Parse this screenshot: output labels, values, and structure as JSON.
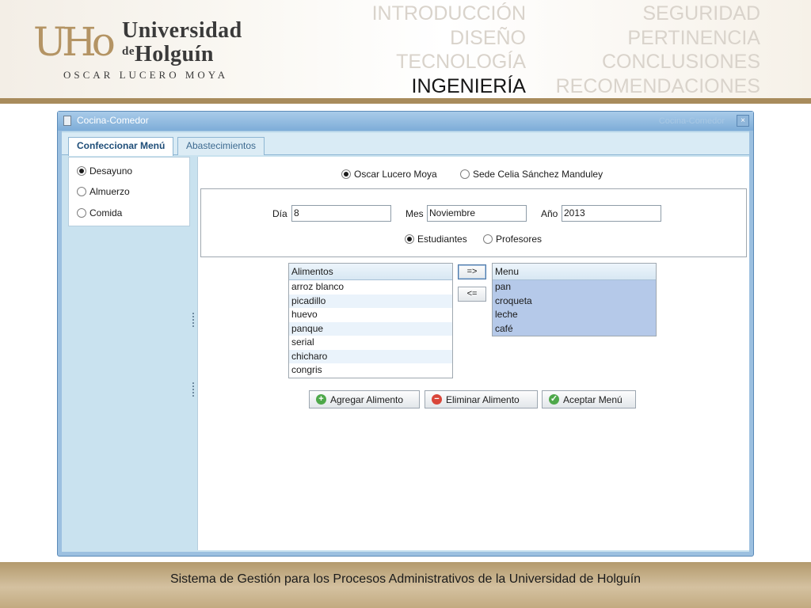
{
  "header": {
    "logo_mark": "UHo",
    "logo_line1": "Universidad",
    "logo_prefix": "de",
    "logo_line2": "Holguín",
    "logo_author": "OSCAR LUCERO MOYA",
    "nav_left": [
      {
        "label": "INTRODUCCIÓN",
        "active": false
      },
      {
        "label": "DISEÑO",
        "active": false
      },
      {
        "label": "TECNOLOGÍA",
        "active": false
      },
      {
        "label": "INGENIERÍA",
        "active": true
      }
    ],
    "nav_right": [
      {
        "label": "SEGURIDAD",
        "active": false
      },
      {
        "label": "PERTINENCIA",
        "active": false
      },
      {
        "label": "CONCLUSIONES",
        "active": false
      },
      {
        "label": "RECOMENDACIONES",
        "active": false
      }
    ]
  },
  "window": {
    "title": "Cocina-Comedor",
    "faint_caption": "Cocina-Comedor",
    "close_glyph": "×",
    "tabs": [
      {
        "label": "Confeccionar Menú",
        "active": true
      },
      {
        "label": "Abastecimientos",
        "active": false
      }
    ]
  },
  "meal_types": [
    {
      "label": "Desayuno",
      "selected": true
    },
    {
      "label": "Almuerzo",
      "selected": false
    },
    {
      "label": "Comida",
      "selected": false
    }
  ],
  "sedes": [
    {
      "label": "Oscar Lucero Moya",
      "selected": true
    },
    {
      "label": "Sede Celia Sánchez Manduley",
      "selected": false
    }
  ],
  "date": {
    "dia_label": "Día",
    "dia_value": "8",
    "mes_label": "Mes",
    "mes_value": "Noviembre",
    "anio_label": "Año",
    "anio_value": "2013"
  },
  "audience": [
    {
      "label": "Estudiantes",
      "selected": true
    },
    {
      "label": "Profesores",
      "selected": false
    }
  ],
  "alimentos": {
    "header": "Alimentos",
    "items": [
      "arroz blanco",
      "picadillo",
      "huevo",
      "panque",
      "serial",
      "chicharo",
      "congris"
    ]
  },
  "menu": {
    "header": "Menu",
    "items": [
      "pan",
      "croqueta",
      "leche",
      "café"
    ]
  },
  "move_buttons": {
    "add": "=>",
    "remove": "<="
  },
  "actions": {
    "add": "Agregar Alimento",
    "remove": "Eliminar Alimento",
    "accept": "Aceptar Menú",
    "add_icon": "plus-icon",
    "remove_icon": "minus-icon",
    "accept_icon": "check-icon"
  },
  "footer": {
    "text": "Sistema de Gestión para los Procesos Administrativos de la Universidad de Holguín"
  },
  "colors": {
    "accent_gold": "#a88b5c",
    "window_blue": "#7eadd8",
    "selection_blue": "#b5c9e9"
  }
}
